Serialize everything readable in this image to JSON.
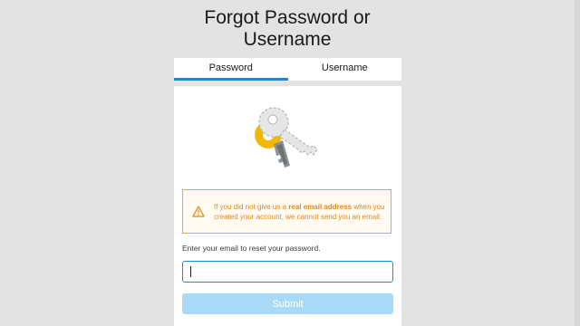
{
  "page": {
    "title_line1": "Forgot Password or",
    "title_line2": "Username"
  },
  "tabs": [
    {
      "label": "Password",
      "active": true
    },
    {
      "label": "Username",
      "active": false
    }
  ],
  "warning": {
    "text_before": "If you did not give us a ",
    "text_bold": "real email address",
    "text_after": " when you created your account, we cannot send you an email."
  },
  "form": {
    "prompt": "Enter your email to reset your password.",
    "email_value": "",
    "email_placeholder": "",
    "submit_label": "Submit"
  },
  "colors": {
    "accent": "#1f8ad2",
    "warning": "#e08a14",
    "submit_disabled": "#a9dbf8",
    "background": "#e3e3e3"
  },
  "icons": {
    "illustration": "keys-illustration-icon",
    "warning": "warning-triangle-icon"
  }
}
